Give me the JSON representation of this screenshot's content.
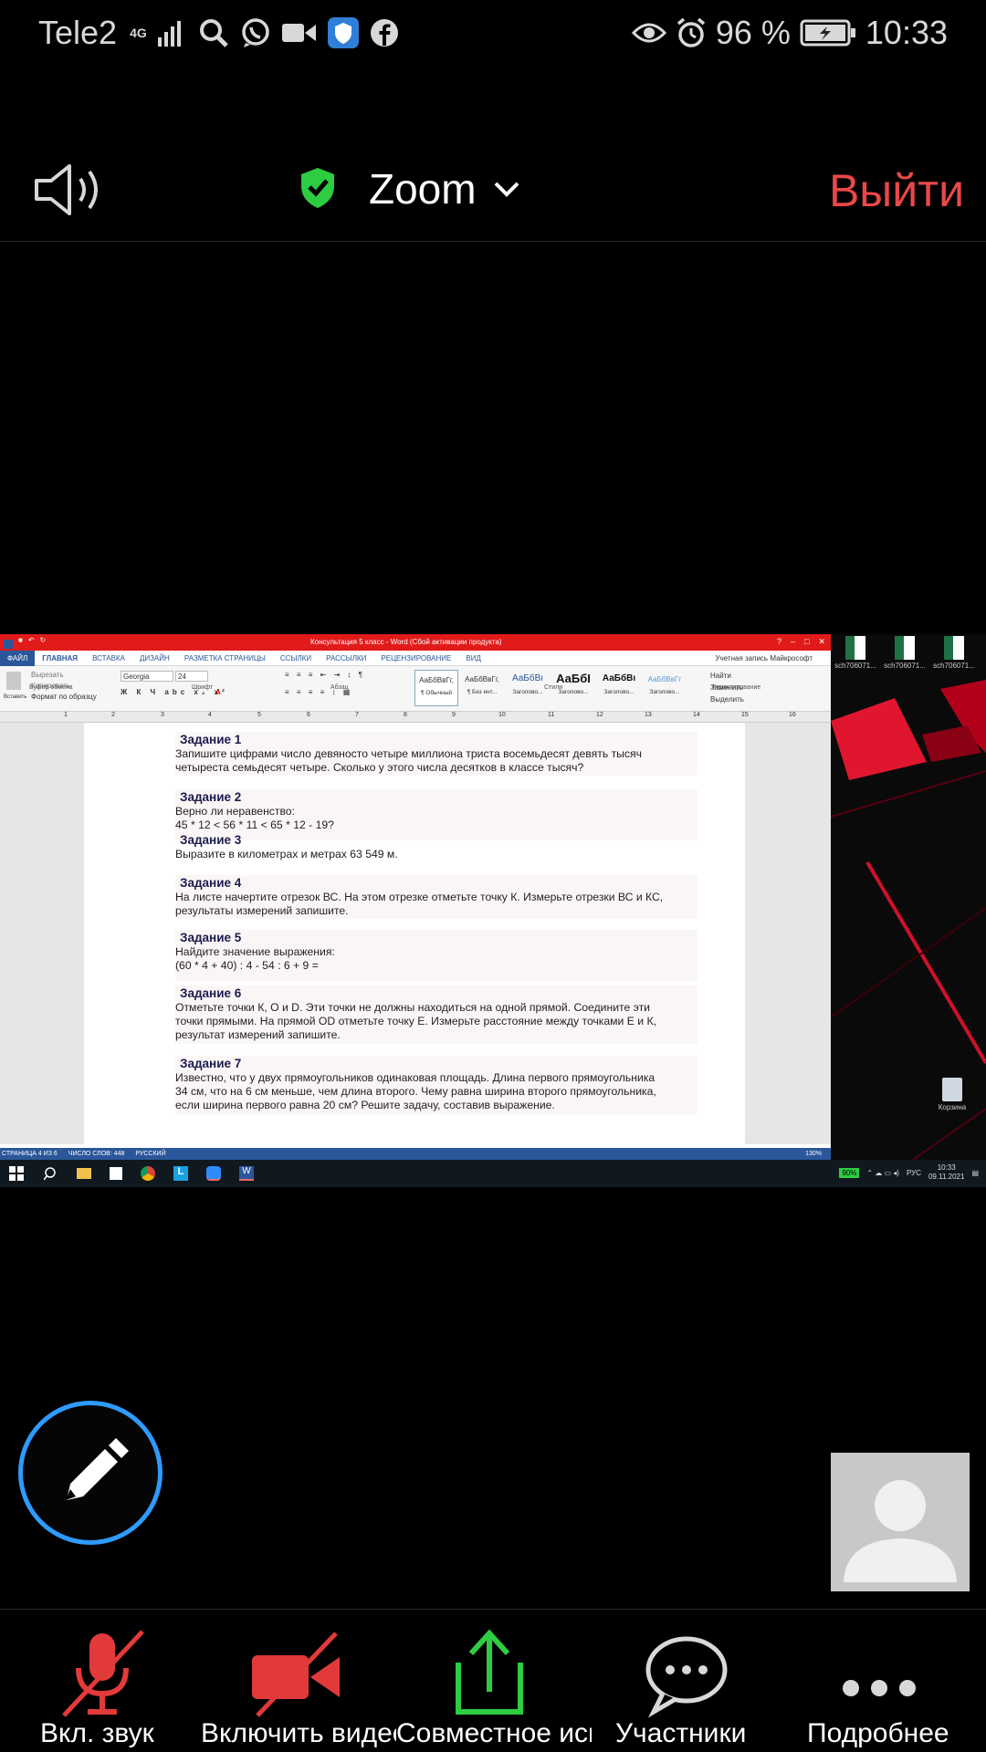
{
  "status_bar": {
    "carrier": "Tele2",
    "network": "4G",
    "battery": "96 %",
    "time": "10:33"
  },
  "top_bar": {
    "title": "Zoom",
    "exit_label": "Выйти"
  },
  "word": {
    "window_title": "Консультация 5 класс - Word (Сбой активации продукта)",
    "tabs": [
      "ФАЙЛ",
      "ГЛАВНАЯ",
      "ВСТАВКА",
      "ДИЗАЙН",
      "РАЗМЕТКА СТРАНИЦЫ",
      "ССЫЛКИ",
      "РАССЫЛКИ",
      "РЕЦЕНЗИРОВАНИЕ",
      "ВИД"
    ],
    "account": "Учетная запись Майкрософт",
    "clipboard": {
      "paste": "Вставить",
      "cut": "Вырезать",
      "copy": "Копировать",
      "format": "Формат по образцу"
    },
    "font_name": "Georgia",
    "font_size": "24",
    "styles": [
      {
        "sample": "АаБбВвГг,",
        "name": "¶ Обычный"
      },
      {
        "sample": "АаБбВвГг,",
        "name": "¶ Без инт..."
      },
      {
        "sample": "АаБбВı",
        "name": "Заголово..."
      },
      {
        "sample": "АаБбI",
        "name": "Заголово..."
      },
      {
        "sample": "АаБбВı",
        "name": "Заголово..."
      },
      {
        "sample": "АаБбВвГг",
        "name": "Заголово..."
      }
    ],
    "editing": {
      "find": "Найти",
      "replace": "Заменить",
      "select": "Выделить"
    },
    "groups": [
      "Буфер обмена",
      "Шрифт",
      "Абзац",
      "Стили",
      "Редактирование"
    ],
    "ruler": [
      "1",
      "2",
      "3",
      "4",
      "5",
      "6",
      "7",
      "8",
      "9",
      "10",
      "11",
      "12",
      "13",
      "14",
      "15",
      "16"
    ],
    "tasks": [
      {
        "title": "Задание 1",
        "lines": [
          "Запишите цифрами число девяносто четыре миллиона триста восемьдесят девять тысяч",
          "четыреста семьдесят четыре. Сколько у этого числа десятков в классе тысяч?"
        ]
      },
      {
        "title": "Задание 2",
        "lines": [
          "Верно ли неравенство:",
          "45 * 12 < 56 * 11 < 65 * 12 - 19?"
        ]
      },
      {
        "title": "Задание 3",
        "lines": [
          "Выразите в километрах и метрах 63 549 м."
        ]
      },
      {
        "title": "Задание 4",
        "lines": [
          "На листе начертите отрезок ВС. На этом отрезке отметьте точку К. Измерьте отрезки ВС и КС,",
          "результаты измерений запишите."
        ]
      },
      {
        "title": "Задание 5",
        "lines": [
          "Найдите значение выражения:",
          "(60 * 4 + 40) : 4 - 54 : 6 + 9 ="
        ]
      },
      {
        "title": "Задание 6",
        "lines": [
          "Отметьте точки К, О и D. Эти точки не должны находиться на одной прямой. Соедините эти",
          "точки прямыми. На прямой OD отметьте точку Е. Измерьте расстояние между точками Е и К,",
          "результат измерений запишите."
        ]
      },
      {
        "title": "Задание 7",
        "lines": [
          "Известно, что у двух прямоугольников одинаковая площадь. Длина первого прямоугольника",
          "34 см, что на 6 см меньше, чем длина второго. Чему равна ширина второго прямоугольника,",
          "если ширина первого равна 20 см? Решите задачу, составив выражение."
        ]
      }
    ],
    "status": {
      "page": "СТРАНИЦА 4 ИЗ 6",
      "words": "ЧИСЛО СЛОВ: 448",
      "lang": "РУССКИЙ",
      "zoom": "130%"
    }
  },
  "desktop": {
    "files": [
      "sch706071...",
      "sch706071...",
      "sch706071..."
    ],
    "recycle_bin": "Корзина"
  },
  "windows_taskbar": {
    "battery": "90%",
    "lang": "РУС",
    "time": "10:33",
    "date": "09.11.2021"
  },
  "bottom_bar": {
    "mute": "Вкл. звук",
    "video": "Включить видео",
    "share": "Совместное использование",
    "participants": "Участники",
    "more": "Подробнее"
  },
  "colors": {
    "exit": "#e84848",
    "pen_ring": "#2e9bff",
    "share_green": "#2ecc40",
    "muted_red": "#e23a3a",
    "word_blue": "#2b579a"
  }
}
